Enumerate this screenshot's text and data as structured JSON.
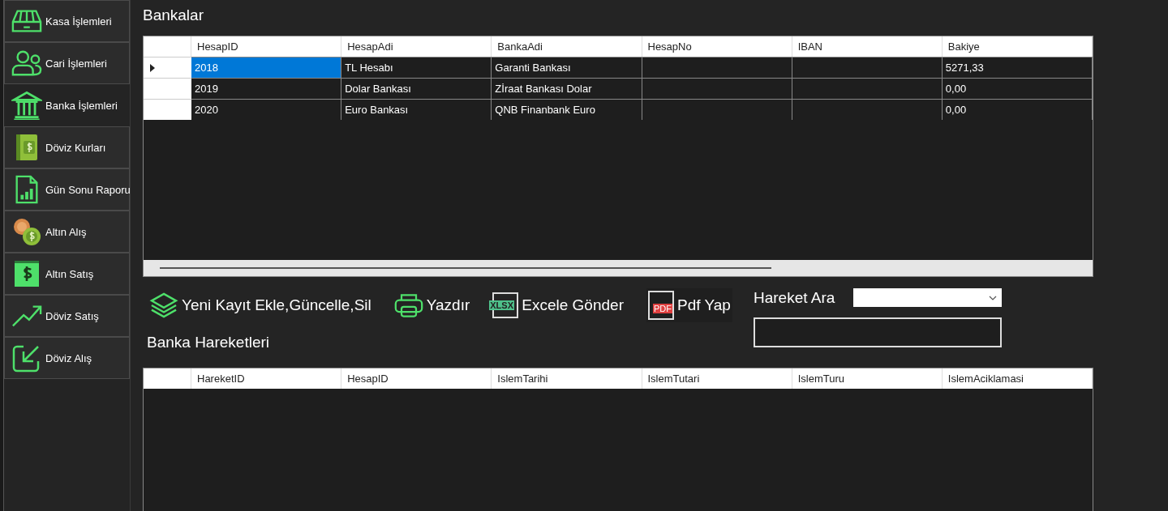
{
  "sidebar": {
    "items": [
      {
        "label": "Kasa İşlemleri",
        "selected": false
      },
      {
        "label": "Cari İşlemleri",
        "selected": false
      },
      {
        "label": "Banka İşlemleri",
        "selected": true
      },
      {
        "label": "Döviz Kurları",
        "selected": false
      },
      {
        "label": "Gün Sonu Raporu",
        "selected": false
      },
      {
        "label": "Altın Alış",
        "selected": false
      },
      {
        "label": "Altın Satış",
        "selected": false
      },
      {
        "label": "Döviz Satış",
        "selected": false
      },
      {
        "label": "Döviz Alış",
        "selected": false
      }
    ]
  },
  "banks": {
    "title": "Bankalar",
    "columns": [
      "HesapID",
      "HesapAdi",
      "BankaAdi",
      "HesapNo",
      "IBAN",
      "Bakiye"
    ],
    "rows": [
      {
        "selected": true,
        "cells": [
          "2018",
          "TL Hesabı",
          "Garanti Bankası",
          "",
          "",
          "5271,33"
        ]
      },
      {
        "selected": false,
        "cells": [
          "2019",
          "Dolar Bankası",
          "Zİraat Bankası Dolar",
          "",
          "",
          "0,00"
        ]
      },
      {
        "selected": false,
        "cells": [
          "2020",
          "Euro Bankası",
          "QNB Finanbank Euro",
          "",
          "",
          "0,00"
        ]
      }
    ]
  },
  "toolbar": [
    {
      "label": "Yeni Kayıt Ekle,Güncelle,Sil"
    },
    {
      "label": "Yazdır"
    },
    {
      "label": "Excele Gönder",
      "badge": "XLSX"
    },
    {
      "label": "Pdf Yap",
      "badge": "PDF"
    }
  ],
  "search": {
    "label": "Hareket Ara"
  },
  "movements": {
    "title": "Banka Hareketleri",
    "columns": [
      "HareketID",
      "HesapID",
      "IslemTarihi",
      "IslemTutari",
      "IslemTuru",
      "IslemAciklamasi"
    ]
  }
}
